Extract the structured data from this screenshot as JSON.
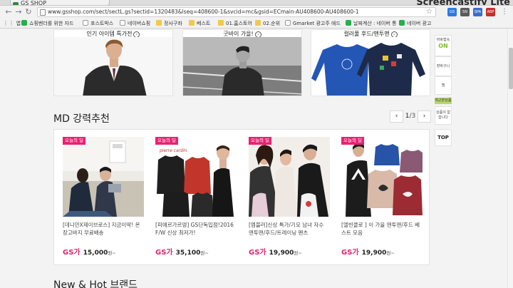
{
  "browser": {
    "tab_title": "GS SHOP",
    "screencastify": "Screencastify Lite",
    "url": "www.gsshop.com/sect/sectL.gs?sectid=1320483&lseq=408600-1&svcid=mc&gsid=ECmain-AU408600-AU408600-1",
    "extensions": [
      "GS",
      "SN",
      "SPA",
      "ABP"
    ],
    "bookmarks": [
      {
        "label": "앱",
        "icon": "apps-icon"
      },
      {
        "label": "쇼핑벤더를 위한 자드",
        "icon": "green"
      },
      {
        "label": "포스트박스",
        "icon": "page"
      },
      {
        "label": "네이버쇼핑",
        "icon": "page"
      },
      {
        "label": "정사구좌",
        "icon": "folder"
      },
      {
        "label": "베스트",
        "icon": "folder"
      },
      {
        "label": "01.홈스토어",
        "icon": "folder"
      },
      {
        "label": "02.순위",
        "icon": "folder"
      },
      {
        "label": "Gmarket 광고주 애드",
        "icon": "page"
      },
      {
        "label": "날짜계산 : 네이버 통",
        "icon": "green"
      },
      {
        "label": "네이버 광고",
        "icon": "green"
      }
    ]
  },
  "brands": [
    {
      "caption": "인기 아이템 특가전"
    },
    {
      "caption": "굿바이 가을!"
    },
    {
      "caption": "컬러풀 후드/맨투맨"
    }
  ],
  "md_section": {
    "title": "MD 강력추천",
    "pager_current": "1",
    "pager_total": "3",
    "pager_sep": "/",
    "prev": "‹",
    "next": "›"
  },
  "products": [
    {
      "badge": "오늘의 딜",
      "desc": "[데니안X제이브로스] 지금이딱! 온장고바지 무료배송",
      "price_label": "GS가",
      "price": "15,000",
      "unit": "원~"
    },
    {
      "badge": "오늘의 딜",
      "desc": "[피에르가르뎅] GS단독입점!2016 F/W 신상 최저가!",
      "price_label": "GS가",
      "price": "35,100",
      "unit": "원~"
    },
    {
      "badge": "오늘의 딜",
      "desc": "[엠블러]신상 특가/기모 남녀 자수 맨투맨/후드/트레이닝 팬츠",
      "price_label": "GS가",
      "price": "19,900",
      "unit": "원~"
    },
    {
      "badge": "오늘의 딜",
      "desc": "[엘빈클로 ] 이 가을 맨투맨/후드 베스트 모음",
      "price_label": "GS가",
      "price": "19,900",
      "unit": "원~"
    }
  ],
  "brand_logo_text": "pierre cardin",
  "new_hot_title": "New & Hot 브랜드",
  "sidebar": {
    "today_label": "바로접속",
    "on_label": "ON",
    "cart_label": "장바구니",
    "wish_label": "찜",
    "recent_label": "최근본상품",
    "empty_label": "상품이 없습니다",
    "top_label": "TOP"
  },
  "colors": {
    "accent": "#e2236d",
    "badge": "#e72270",
    "side_on": "#7cbf2a"
  }
}
